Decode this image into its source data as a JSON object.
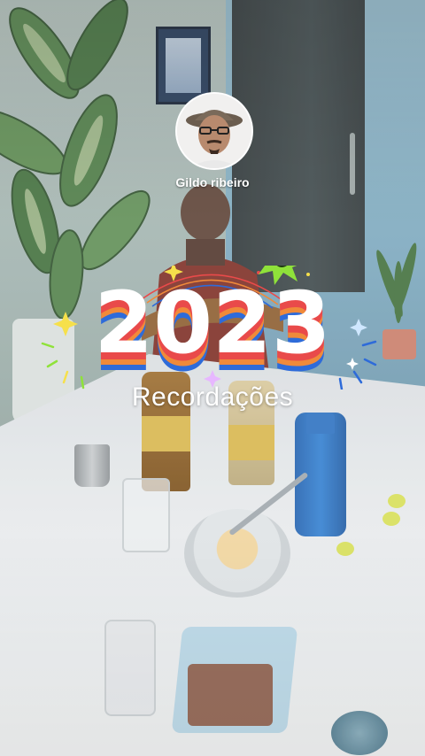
{
  "profile": {
    "username": "Gildo ribeiro",
    "avatar_icon": "user-avatar-photo"
  },
  "recap": {
    "year": "2023",
    "subtitle": "Recordações"
  },
  "colors": {
    "year_fill": "#ffffff",
    "stripe_red": "#e94a4a",
    "stripe_orange": "#f08a3a",
    "stripe_blue": "#2e6bd9",
    "sparkle_green": "#8fe23a",
    "sparkle_yellow": "#f6e04b"
  }
}
